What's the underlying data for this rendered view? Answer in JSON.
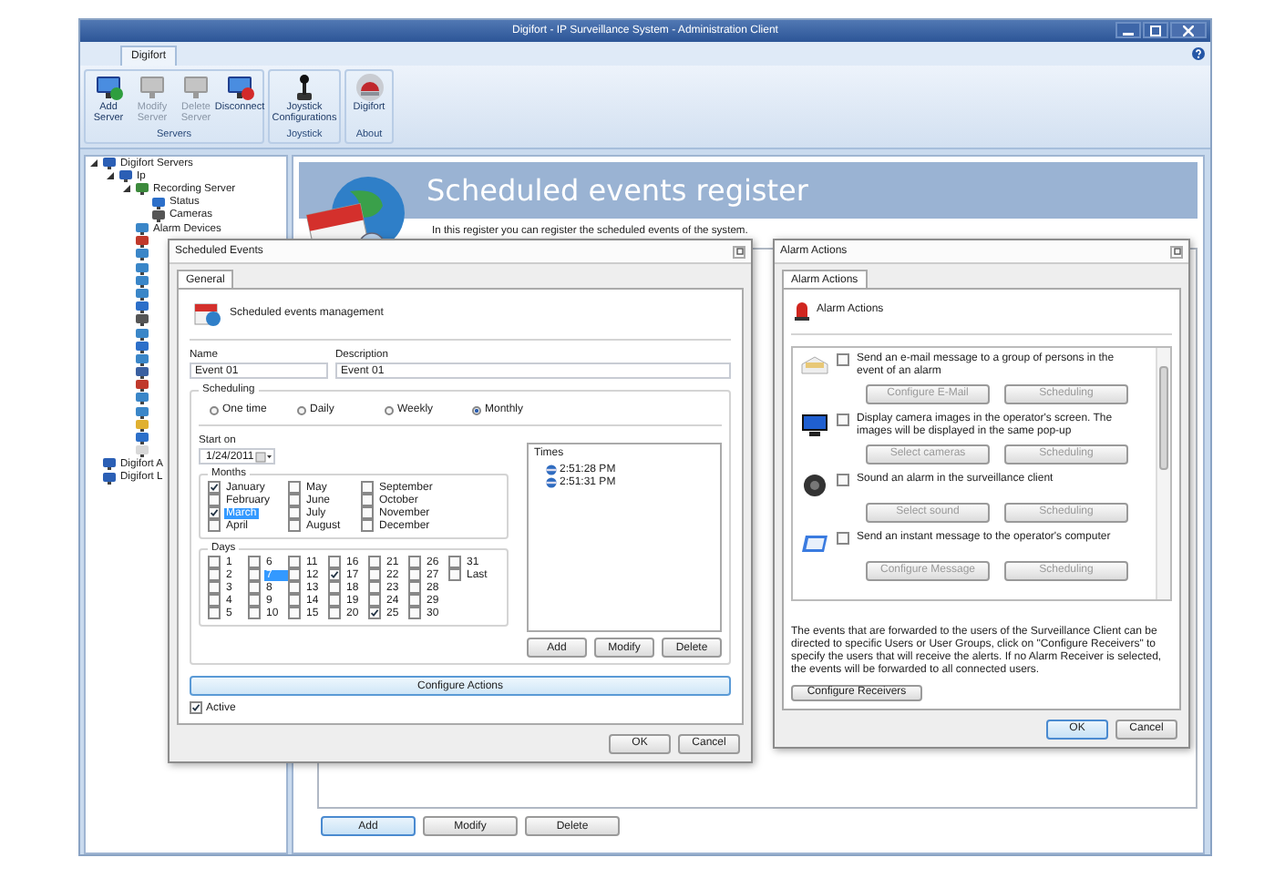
{
  "window": {
    "title": "Digifort - IP Surveillance System - Administration Client"
  },
  "ribbon": {
    "tabs": [
      {
        "label": "Digifort",
        "selected": true
      }
    ],
    "groups": [
      {
        "label": "Servers",
        "buttons": [
          {
            "label": "Add Server",
            "kind": "add",
            "disabled": false
          },
          {
            "label": "Modify Server",
            "kind": "modify",
            "disabled": true
          },
          {
            "label": "Delete Server",
            "kind": "delete",
            "disabled": true
          },
          {
            "label": "Disconnect",
            "kind": "disconnect",
            "disabled": false
          }
        ]
      },
      {
        "label": "Joystick",
        "buttons": [
          {
            "label": "Joystick Configurations",
            "kind": "joystick",
            "disabled": false
          }
        ]
      },
      {
        "label": "About",
        "buttons": [
          {
            "label": "Digifort",
            "kind": "logo",
            "disabled": false
          }
        ]
      }
    ]
  },
  "tree": [
    {
      "label": "Digifort Servers",
      "kind": "server",
      "expanded": true,
      "children": [
        {
          "label": "Ip",
          "kind": "server",
          "expanded": true,
          "children": [
            {
              "label": "Recording Server",
              "kind": "recording",
              "expanded": true,
              "children": [
                {
                  "label": "Status",
                  "kind": "status"
                },
                {
                  "label": "Cameras",
                  "kind": "camera"
                }
              ]
            },
            {
              "label": "Alarm Devices",
              "kind": "globe"
            },
            {
              "kind": "alarm"
            },
            {
              "kind": "globe"
            },
            {
              "kind": "globe"
            },
            {
              "kind": "globe"
            },
            {
              "kind": "globe"
            },
            {
              "kind": "status"
            },
            {
              "kind": "camera"
            },
            {
              "kind": "globe"
            },
            {
              "kind": "status"
            },
            {
              "kind": "globe"
            },
            {
              "kind": "grid"
            },
            {
              "kind": "alarm"
            },
            {
              "kind": "globe"
            },
            {
              "kind": "globe"
            },
            {
              "kind": "key"
            },
            {
              "kind": "status"
            },
            {
              "kind": "blank"
            }
          ]
        }
      ]
    },
    {
      "label": "Digifort A",
      "kind": "server"
    },
    {
      "label": "Digifort L",
      "kind": "server"
    }
  ],
  "main": {
    "title": "Scheduled events register",
    "subtitle": "In this register you can register the scheduled events of the system.",
    "buttons": [
      {
        "label": "Add",
        "focused": true
      },
      {
        "label": "Modify",
        "focused": false
      },
      {
        "label": "Delete",
        "focused": false
      }
    ]
  },
  "scheduled_dialog": {
    "title": "Scheduled Events",
    "tabs": [
      {
        "label": "General",
        "selected": true
      }
    ],
    "heading": "Scheduled events management",
    "name": {
      "label": "Name",
      "value": "Event 01"
    },
    "description": {
      "label": "Description",
      "value": "Event 01"
    },
    "scheduling": {
      "label": "Scheduling",
      "options": [
        {
          "label": "One time",
          "selected": false
        },
        {
          "label": "Daily",
          "selected": false
        },
        {
          "label": "Weekly",
          "selected": false
        },
        {
          "label": "Monthly",
          "selected": true
        }
      ],
      "start_label": "Start on",
      "start_date": "1/24/2011",
      "months_label": "Months",
      "months": [
        {
          "label": "January",
          "checked": true,
          "selected": false
        },
        {
          "label": "February",
          "checked": false,
          "selected": false
        },
        {
          "label": "March",
          "checked": true,
          "selected": true
        },
        {
          "label": "April",
          "checked": false,
          "selected": false
        },
        {
          "label": "May",
          "checked": false,
          "selected": false
        },
        {
          "label": "June",
          "checked": false,
          "selected": false
        },
        {
          "label": "July",
          "checked": false,
          "selected": false
        },
        {
          "label": "August",
          "checked": false,
          "selected": false
        },
        {
          "label": "September",
          "checked": false,
          "selected": false
        },
        {
          "label": "October",
          "checked": false,
          "selected": false
        },
        {
          "label": "November",
          "checked": false,
          "selected": false
        },
        {
          "label": "December",
          "checked": false,
          "selected": false
        }
      ],
      "days_label": "Days",
      "days": [
        {
          "label": "1",
          "checked": false,
          "selected": false
        },
        {
          "label": "2",
          "checked": false,
          "selected": false
        },
        {
          "label": "3",
          "checked": false,
          "selected": false
        },
        {
          "label": "4",
          "checked": false,
          "selected": false
        },
        {
          "label": "5",
          "checked": false,
          "selected": false
        },
        {
          "label": "6",
          "checked": false,
          "selected": false
        },
        {
          "label": "7",
          "checked": false,
          "selected": true
        },
        {
          "label": "8",
          "checked": false,
          "selected": false
        },
        {
          "label": "9",
          "checked": false,
          "selected": false
        },
        {
          "label": "10",
          "checked": false,
          "selected": false
        },
        {
          "label": "11",
          "checked": false,
          "selected": false
        },
        {
          "label": "12",
          "checked": false,
          "selected": false
        },
        {
          "label": "13",
          "checked": false,
          "selected": false
        },
        {
          "label": "14",
          "checked": false,
          "selected": false
        },
        {
          "label": "15",
          "checked": false,
          "selected": false
        },
        {
          "label": "16",
          "checked": false,
          "selected": false
        },
        {
          "label": "17",
          "checked": true,
          "selected": false
        },
        {
          "label": "18",
          "checked": false,
          "selected": false
        },
        {
          "label": "19",
          "checked": false,
          "selected": false
        },
        {
          "label": "20",
          "checked": false,
          "selected": false
        },
        {
          "label": "21",
          "checked": false,
          "selected": false
        },
        {
          "label": "22",
          "checked": false,
          "selected": false
        },
        {
          "label": "23",
          "checked": false,
          "selected": false
        },
        {
          "label": "24",
          "checked": false,
          "selected": false
        },
        {
          "label": "25",
          "checked": true,
          "selected": false
        },
        {
          "label": "26",
          "checked": false,
          "selected": false
        },
        {
          "label": "27",
          "checked": false,
          "selected": false
        },
        {
          "label": "28",
          "checked": false,
          "selected": false
        },
        {
          "label": "29",
          "checked": false,
          "selected": false
        },
        {
          "label": "30",
          "checked": false,
          "selected": false
        },
        {
          "label": "31",
          "checked": false,
          "selected": false
        },
        {
          "label": "Last",
          "checked": false,
          "selected": false
        }
      ],
      "times_label": "Times",
      "times": [
        "2:51:28 PM",
        "2:51:31 PM"
      ],
      "time_buttons": [
        "Add",
        "Modify",
        "Delete"
      ]
    },
    "configure_button": "Configure Actions",
    "active": {
      "label": "Active",
      "checked": true
    },
    "buttons": [
      "OK",
      "Cancel"
    ]
  },
  "alarm_dialog": {
    "title": "Alarm Actions",
    "tabs": [
      {
        "label": "Alarm Actions",
        "selected": true
      }
    ],
    "heading": "Alarm Actions",
    "actions": [
      {
        "kind": "email",
        "checked": false,
        "text": "Send an e-mail message to a group of persons in the event of an alarm",
        "buttons": [
          "Configure E-Mail",
          "Scheduling"
        ]
      },
      {
        "kind": "monitor",
        "checked": false,
        "text": "Display camera images in the operator's screen. The images will be displayed in the same pop-up",
        "buttons": [
          "Select cameras",
          "Scheduling"
        ]
      },
      {
        "kind": "speaker",
        "checked": false,
        "text": "Sound an alarm in the surveillance client",
        "buttons": [
          "Select sound",
          "Scheduling"
        ]
      },
      {
        "kind": "message",
        "checked": false,
        "text": "Send an instant message to the operator's computer",
        "buttons": [
          "Configure Message",
          "Scheduling"
        ]
      }
    ],
    "note": "The events that are forwarded to the users of the Surveillance Client can be directed to specific Users or User Groups, click on \"Configure Receivers\" to specify the users that will receive the alerts. If no Alarm Receiver is selected, the events will be forwarded to all connected users.",
    "receivers_button": "Configure Receivers",
    "buttons": [
      {
        "label": "OK",
        "focused": true
      },
      {
        "label": "Cancel",
        "focused": false
      }
    ]
  }
}
